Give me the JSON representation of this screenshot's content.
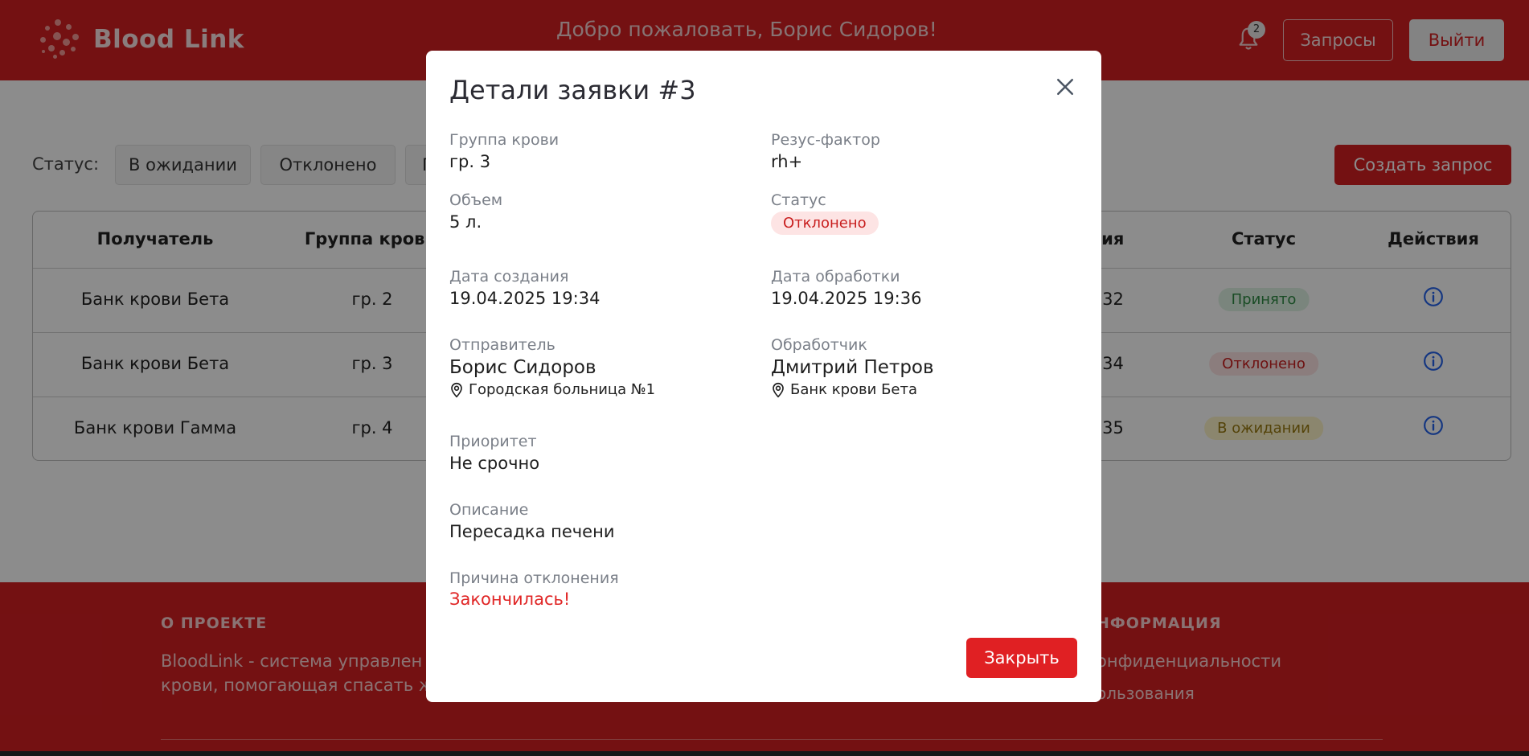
{
  "header": {
    "app_name": "Blood Link",
    "welcome": "Добро пожаловать, Борис Сидоров!",
    "notification_count": "2",
    "requests_button": "Запросы",
    "logout_button": "Выйти"
  },
  "filters": {
    "label": "Статус:",
    "items": [
      "В ожидании",
      "Отклонено",
      "П"
    ],
    "create_button": "Создать запрос"
  },
  "table": {
    "headers": [
      "Получатель",
      "Группа крови",
      "ния",
      "Статус",
      "Действия"
    ],
    "rows": [
      {
        "recipient": "Банк крови Бета",
        "group": "гр. 2",
        "date_fragment": ":32",
        "status": "Принято"
      },
      {
        "recipient": "Банк крови Бета",
        "group": "гр. 3",
        "date_fragment": ":34",
        "status": "Отклонено"
      },
      {
        "recipient": "Банк крови Гамма",
        "group": "гр. 4",
        "date_fragment": ":35",
        "status": "В ожидании"
      }
    ]
  },
  "footer": {
    "about_heading": "О ПРОЕКТЕ",
    "about_text_1": "BloodLink - система управлен",
    "about_text_2": "крови, помогающая спасать ж",
    "info_heading": "НФОРМАЦИЯ",
    "info_link_1": "онфиденциальности",
    "info_link_2": "ользования"
  },
  "modal": {
    "title": "Детали заявки #3",
    "blood_group_label": "Группа крови",
    "blood_group_value": "гр. 3",
    "rhesus_label": "Резус-фактор",
    "rhesus_value": "rh+",
    "volume_label": "Объем",
    "volume_value": "5 л.",
    "status_label": "Статус",
    "status_value": "Отклонено",
    "created_label": "Дата создания",
    "created_value": "19.04.2025 19:34",
    "processed_label": "Дата обработки",
    "processed_value": "19.04.2025 19:36",
    "sender_label": "Отправитель",
    "sender_name": "Борис Сидоров",
    "sender_location": "Городская больница №1",
    "handler_label": "Обработчик",
    "handler_name": "Дмитрий Петров",
    "handler_location": "Банк крови Бета",
    "priority_label": "Приоритет",
    "priority_value": "Не срочно",
    "description_label": "Описание",
    "description_value": "Пересадка печени",
    "reject_reason_label": "Причина отклонения",
    "reject_reason_value": "Закончилась!",
    "close_button": "Закрыть"
  },
  "colors": {
    "brand_red": "#d41f22",
    "accepted_badge_bg": "#dff3e3",
    "accepted_badge_text": "#2f8a44",
    "rejected_badge_bg": "#fde4e4",
    "rejected_badge_text": "#c81e1e",
    "pending_badge_bg": "#fdf4c8",
    "pending_badge_text": "#9a7b12",
    "info_icon": "#2563eb"
  }
}
